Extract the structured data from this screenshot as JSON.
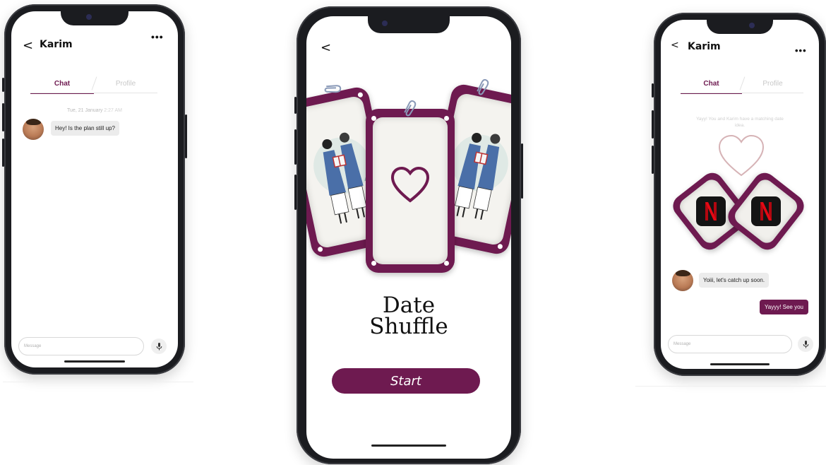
{
  "colors": {
    "accent": "#6e1a50",
    "bubble_in": "#ececec",
    "phone_frame": "#1b1c20"
  },
  "left_phone": {
    "header": {
      "back_icon": "<",
      "title": "Karim",
      "more_icon": "•••"
    },
    "tabs": [
      {
        "label": "Chat",
        "active": true
      },
      {
        "label": "Profile",
        "active": false
      }
    ],
    "timestamp": {
      "date": "Tue, 21 January",
      "time": "2:27 AM"
    },
    "messages": [
      {
        "from": "Karim",
        "text": "Hey! Is the plan still up?"
      }
    ],
    "composer": {
      "placeholder": "Message",
      "mic_icon": "microphone-icon"
    }
  },
  "center_phone": {
    "header": {
      "back_icon": "<"
    },
    "title_line1": "Date",
    "title_line2": "Shuffle",
    "start_label": "Start"
  },
  "right_phone": {
    "header": {
      "back_icon": "<",
      "title": "Karim",
      "more_icon": "•••"
    },
    "tabs": [
      {
        "label": "Chat",
        "active": true
      },
      {
        "label": "Profile",
        "active": false
      }
    ],
    "match_text": "Yayy! You and Karim have a matching date idea.",
    "messages": [
      {
        "from": "Karim",
        "text": "Yoiii, let's catch up soon."
      },
      {
        "from": "me",
        "text": "Yayyy! See you"
      }
    ],
    "composer": {
      "placeholder": "Message",
      "mic_icon": "microphone-icon"
    }
  }
}
